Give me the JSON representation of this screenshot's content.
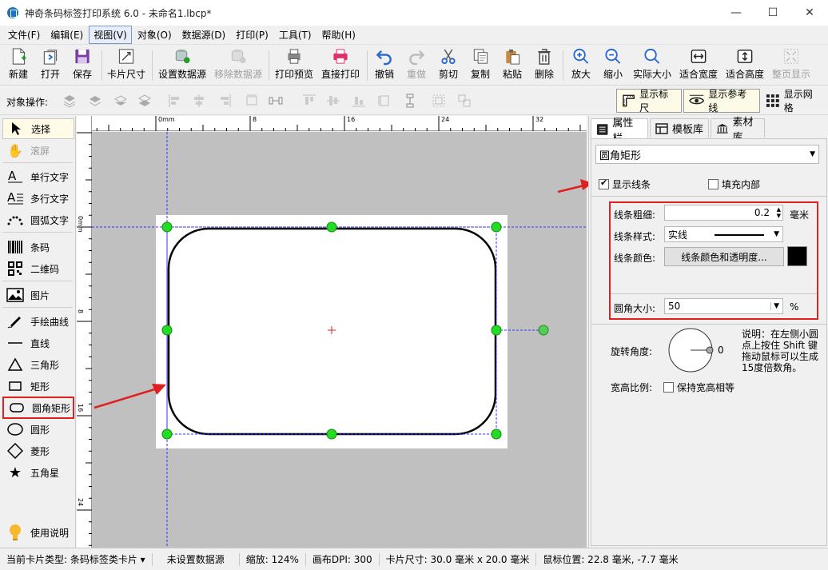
{
  "window": {
    "title": "神奇条码标签打印系统 6.0 - 未命名1.lbcp*",
    "minimize": "—",
    "maximize": "☐",
    "close": "✕"
  },
  "menu": [
    "文件(F)",
    "编辑(E)",
    "视图(V)",
    "对象(O)",
    "数据源(D)",
    "打印(P)",
    "工具(T)",
    "帮助(H)"
  ],
  "toolbar": {
    "new": "新建",
    "open": "打开",
    "save": "保存",
    "card_size": "卡片尺寸",
    "set_datasource": "设置数据源",
    "remove_datasource": "移除数据源",
    "print_preview": "打印预览",
    "direct_print": "直接打印",
    "undo": "撤销",
    "redo": "重做",
    "cut": "剪切",
    "copy": "复制",
    "paste": "粘贴",
    "delete": "删除",
    "zoom_in": "放大",
    "zoom_out": "缩小",
    "actual_size": "实际大小",
    "fit_width": "适合宽度",
    "fit_height": "适合高度",
    "fit_page": "整页显示"
  },
  "objrow": {
    "label": "对象操作:",
    "show_ruler": "显示标尺",
    "show_guides": "显示参考线",
    "show_grid": "显示网格"
  },
  "tools": {
    "select": "选择",
    "scroll": "滚屏",
    "single_text": "单行文字",
    "multi_text": "多行文字",
    "arc_text": "圆弧文字",
    "barcode": "条码",
    "qrcode": "二维码",
    "image": "图片",
    "freehand": "手绘曲线",
    "line": "直线",
    "triangle": "三角形",
    "rectangle": "矩形",
    "rounded_rect": "圆角矩形",
    "circle": "圆形",
    "diamond": "菱形",
    "star": "五角星",
    "help": "使用说明"
  },
  "ruler": {
    "top_ticks": [
      "0mm",
      "8",
      "16",
      "24",
      "32"
    ],
    "left_ticks": [
      "0mm",
      "8",
      "16",
      "24"
    ]
  },
  "panel": {
    "tabs": [
      "属性栏",
      "模板库",
      "素材库"
    ],
    "object_type": "圆角矩形",
    "show_stroke": "显示线条",
    "fill_inside": "填充内部",
    "stroke_width_label": "线条粗细:",
    "stroke_width_value": "0.2",
    "stroke_width_unit": "毫米",
    "stroke_style_label": "线条样式:",
    "stroke_style_value": "实线",
    "stroke_color_label": "线条颜色:",
    "stroke_color_button": "线条颜色和透明度...",
    "stroke_color": "#000000",
    "corner_label": "圆角大小:",
    "corner_value": "50",
    "corner_unit": "%",
    "rotate_label": "旋转角度:",
    "rotate_value": "0",
    "rotate_note": "说明：在左侧小圆点上按住 Shift 键拖动鼠标可以生成15度倍数角。",
    "aspect_label": "宽高比例:",
    "aspect_keep": "保持宽高相等"
  },
  "status": {
    "card_type": "当前卡片类型: 条码标签类卡片",
    "datasource": "未设置数据源",
    "zoom": "缩放: 124%",
    "dpi": "画布DPI: 300",
    "card_size": "卡片尺寸: 30.0 毫米 x 20.0 毫米",
    "mouse_pos": "鼠标位置: 22.8 毫米, -7.7 毫米"
  },
  "colors": {
    "highlight_red": "#e02020",
    "handle_green": "#22cc22",
    "guide_blue": "#3333ff",
    "canvas_gray": "#c0c0c0"
  }
}
